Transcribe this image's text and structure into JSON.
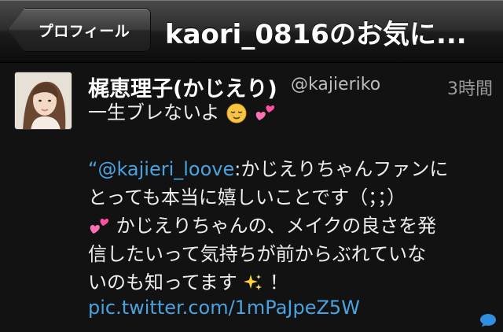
{
  "navbar": {
    "back_label": "プロフィール",
    "title": "kaori_0816のお気に..."
  },
  "tweet": {
    "display_name": "梶恵理子(かじえり)",
    "screen_name": "@kajieriko",
    "timestamp": "3時間",
    "line1": "一生ブレないよ",
    "quote_open": "“",
    "mention": "@kajieri_loove",
    "line3_rest": ":かじえりちゃんファンに",
    "line4": "とっても本当に嬉しいことです（；；）",
    "line5": "かじえりちゃんの、メイクの良さを発",
    "line6": "信したいって気持ちが前からぶれていな",
    "line7a": "いのも知ってます",
    "line7b": "！",
    "link": "pic.twitter.com/1mPaJpeZ5W"
  },
  "colors": {
    "background": "#121212",
    "link": "#4aa3e0",
    "reply_icon": "#2f8fe0"
  },
  "icons": {
    "emoji_relieved": "relieved-face-icon",
    "emoji_hearts": "two-hearts-icon",
    "emoji_sparkles": "sparkles-icon",
    "reply": "speech-bubble-icon"
  }
}
